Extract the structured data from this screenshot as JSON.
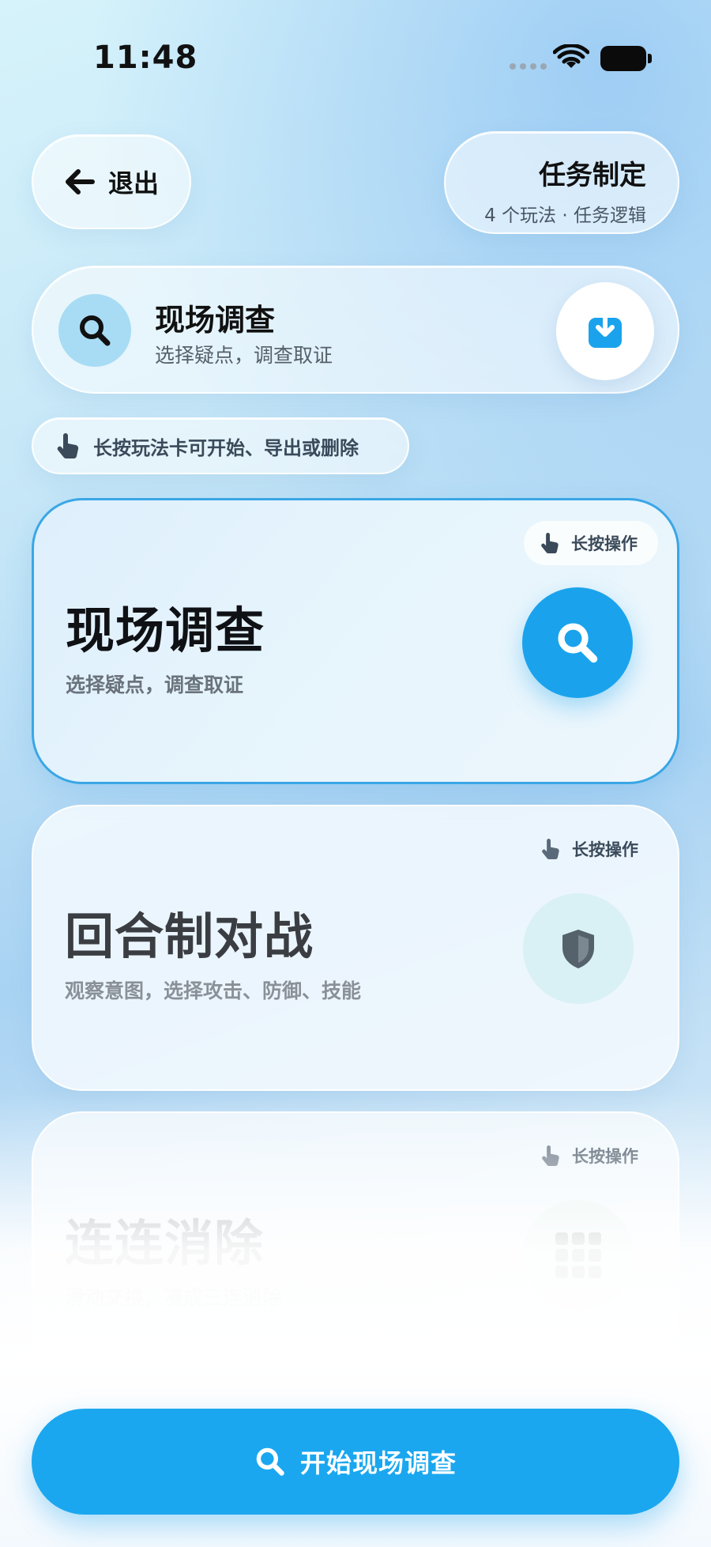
{
  "status_bar": {
    "time": "11:48"
  },
  "header": {
    "exit_label": "退出",
    "task_title": "任务制定",
    "task_subtitle": "4 个玩法 · 任务逻辑"
  },
  "current_mode": {
    "title": "现场调查",
    "subtitle": "选择疑点，调查取证",
    "icon": "search-icon",
    "export_icon": "download-icon"
  },
  "hint": {
    "text": "长按玩法卡可开始、导出或删除",
    "icon": "hand-pointer-icon"
  },
  "cards": [
    {
      "title": "现场调查",
      "subtitle": "选择疑点，调查取证",
      "badge": "长按操作",
      "icon": "search-icon",
      "selected": true
    },
    {
      "title": "回合制对战",
      "subtitle": "观察意图，选择攻击、防御、技能",
      "badge": "长按操作",
      "icon": "shield-icon",
      "selected": false
    },
    {
      "title": "连连消除",
      "subtitle": "滑动交换，凑成三连消除",
      "badge": "长按操作",
      "icon": "grid-icon",
      "selected": false
    }
  ],
  "start_button": {
    "label": "开始现场调查",
    "icon": "search-icon"
  },
  "colors": {
    "accent": "#1aa7ef",
    "active_border": "#3aa6e6"
  }
}
